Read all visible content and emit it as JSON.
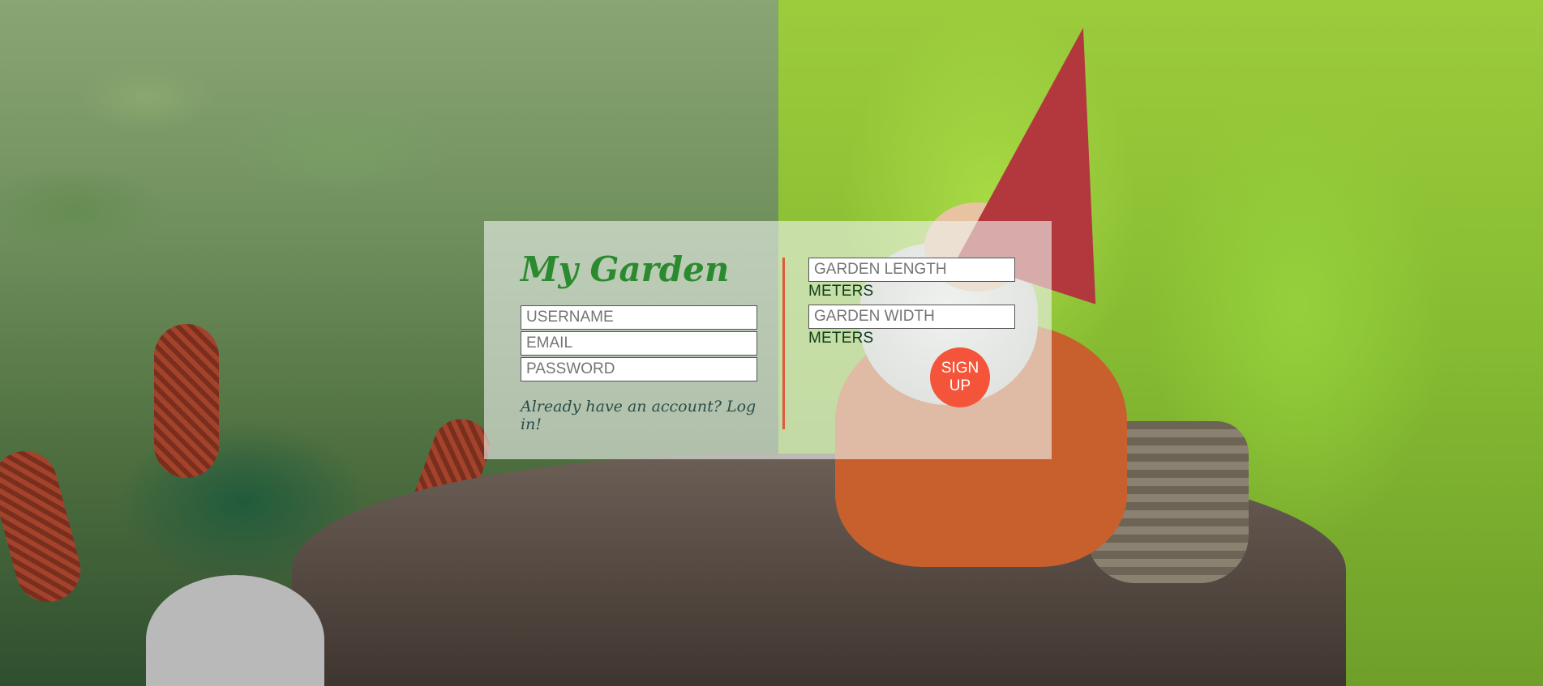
{
  "background": {
    "description_icon": "garden-gnome-photo"
  },
  "form": {
    "title": "My Garden",
    "username_placeholder": "USERNAME",
    "email_placeholder": "EMAIL",
    "password_placeholder": "PASSWORD",
    "login_link": "Already have an account? Log in!",
    "garden_length_placeholder": "GARDEN LENGTH",
    "garden_length_unit": "METERS",
    "garden_width_placeholder": "GARDEN WIDTH",
    "garden_width_unit": "METERS",
    "signup_label": "SIGN UP"
  },
  "colors": {
    "title": "#2b8a2f",
    "accent": "#f4543a",
    "divider": "#e0593a"
  }
}
